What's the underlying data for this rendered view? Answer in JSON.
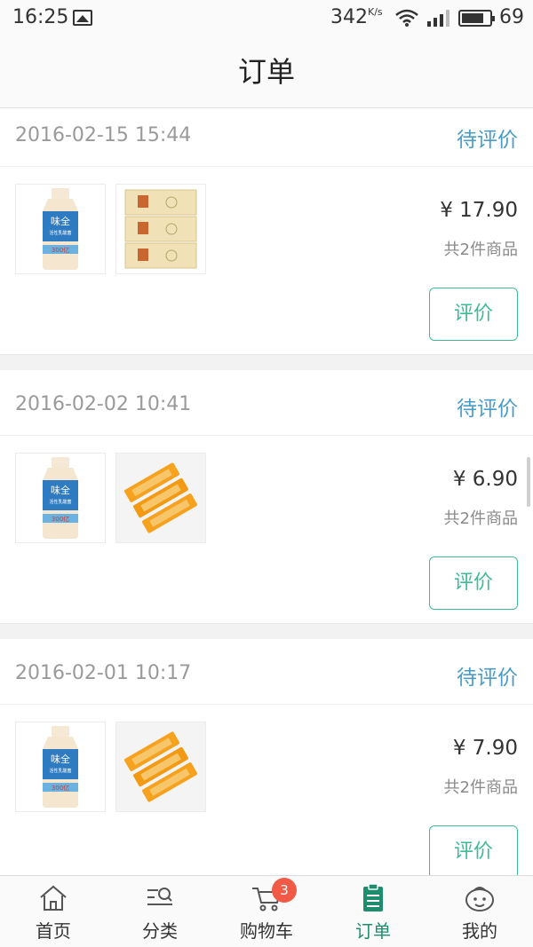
{
  "status_bar": {
    "time": "16:25",
    "speed": "342",
    "speed_unit": "K/s",
    "battery": "69"
  },
  "header": {
    "title": "订单"
  },
  "orders": [
    {
      "date": "2016-02-15 15:44",
      "status": "待评价",
      "price": "¥ 17.90",
      "count": "共2件商品",
      "action": "评价",
      "items": [
        "yogurt-drink",
        "tissue-pack"
      ]
    },
    {
      "date": "2016-02-02 10:41",
      "status": "待评价",
      "price": "¥ 6.90",
      "count": "共2件商品",
      "action": "评价",
      "items": [
        "yogurt-drink",
        "orange-snack"
      ]
    },
    {
      "date": "2016-02-01 10:17",
      "status": "待评价",
      "price": "¥ 7.90",
      "count": "共2件商品",
      "action": "评价",
      "items": [
        "yogurt-drink",
        "orange-snack"
      ]
    }
  ],
  "tabbar": {
    "tabs": [
      {
        "label": "首页",
        "icon": "home-icon"
      },
      {
        "label": "分类",
        "icon": "category-search-icon"
      },
      {
        "label": "购物车",
        "icon": "cart-icon",
        "badge": "3"
      },
      {
        "label": "订单",
        "icon": "order-clipboard-icon",
        "active": true
      },
      {
        "label": "我的",
        "icon": "profile-face-icon"
      }
    ]
  },
  "colors": {
    "accent_green": "#3dbb96",
    "status_blue": "#4a9cc6",
    "active_tab": "#1e8d6e",
    "badge_red": "#f05a46"
  },
  "product_image_text": {
    "yogurt_brand": "味全",
    "yogurt_sub": "活性乳酸菌",
    "yogurt_badge": "300亿"
  }
}
